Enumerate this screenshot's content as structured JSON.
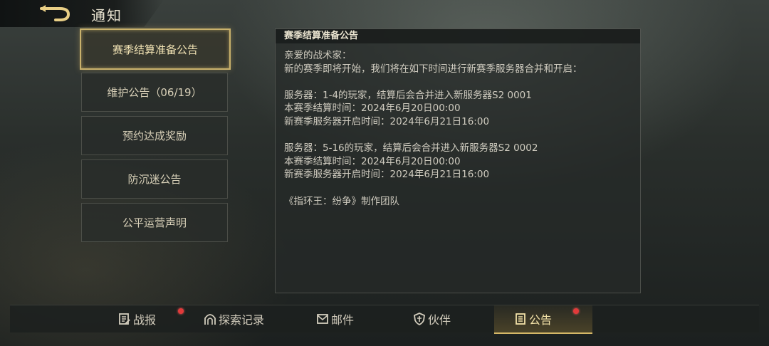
{
  "header": {
    "title": "通知",
    "back_icon": "back-arrow-icon"
  },
  "notices": [
    {
      "label": "赛季结算准备公告",
      "active": true
    },
    {
      "label": "维护公告（06/19）"
    },
    {
      "label": "预约达成奖励"
    },
    {
      "label": "防沉迷公告"
    },
    {
      "label": "公平运营声明"
    }
  ],
  "content": {
    "heading": "赛季结算准备公告",
    "lines": [
      "亲爱的战术家：",
      "新的赛季即将开始，我们将在如下时间进行新赛季服务器合并和开启：",
      "",
      "服务器：1-4的玩家，结算后会合并进入新服务器S2 0001",
      "本赛季结算时间：2024年6月20日00:00",
      "新赛季服务器开启时间：2024年6月21日16:00",
      "",
      "服务器：5-16的玩家，结算后会合并进入新服务器S2 0002",
      "本赛季结算时间：2024年6月20日00:00",
      "新赛季服务器开启时间：2024年6月21日16:00",
      "",
      "《指环王：纷争》制作团队"
    ]
  },
  "bottom_nav": {
    "tabs": [
      {
        "label": "战报",
        "icon": "battle-report-icon",
        "badge": true
      },
      {
        "label": "探索记录",
        "icon": "gate-icon",
        "badge": false
      },
      {
        "label": "邮件",
        "icon": "mail-icon",
        "badge": false
      },
      {
        "label": "伙伴",
        "icon": "shield-icon",
        "badge": false
      },
      {
        "label": "公告",
        "icon": "notice-board-icon",
        "badge": true,
        "active": true
      }
    ]
  },
  "colors": {
    "accent": "#c9b16c",
    "badge": "#e23a3a"
  }
}
